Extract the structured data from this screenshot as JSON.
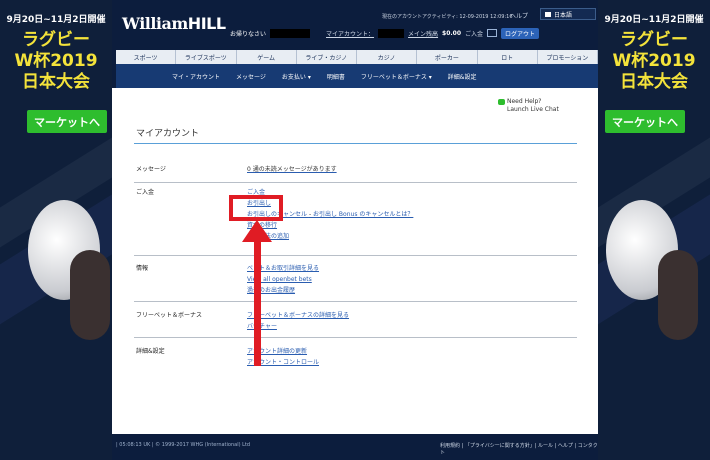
{
  "banner": {
    "dates": "9月20日~11月2日開催",
    "line1": "ラグビー",
    "line2": "W杯2019",
    "line3": "日本大会",
    "button": "マーケットへ"
  },
  "header": {
    "logo_script": "William",
    "logo_block": "HILL",
    "activity_link": "現在のアカウントアクティビティ: 12-09-2019 12:09:16",
    "help": "ヘルプ",
    "language": "日本語",
    "greeting": "お帰りなさい",
    "my_account": "マイアカウント：",
    "main_wallet": "メイン残高",
    "balance": "$0.00",
    "deposit": "ご入金",
    "logout": "ログアウト"
  },
  "nav_primary": [
    "スポーツ",
    "ライブスポーツ",
    "ゲーム",
    "ライブ・カジノ",
    "カジノ",
    "ポーカー",
    "ロト",
    "プロモーション"
  ],
  "nav_secondary": [
    "マイ・アカウント",
    "メッセージ",
    "お支払い ▾",
    "明細書",
    "フリーベット＆ボーナス ▾",
    "詳細&設定"
  ],
  "content": {
    "need_help": "Need Help?",
    "live_chat": "Launch Live Chat",
    "page_title": "マイアカウント",
    "sections": [
      {
        "label": "メッセージ",
        "links": [
          "0 通の未読メッセージがあります"
        ]
      },
      {
        "label": "ご入金",
        "links": [
          "ご入金",
          "お引出し",
          "お引出しのキャンセル",
          "お引出し Bonus のキャンセルとは？",
          "資金の移行",
          "入金方法の追加"
        ]
      },
      {
        "label": "情報",
        "links": [
          "ベット＆お取引詳細を見る",
          "View all openbet bets",
          "過去のお出金履歴"
        ]
      },
      {
        "label": "フリーベット＆ボーナス",
        "links": [
          "フリーベット＆ボーナスの詳細を見る",
          "バウチャー"
        ]
      },
      {
        "label": "詳細&設定",
        "links": [
          "アカウント詳細の更新",
          "アカウント・コントロール"
        ]
      }
    ]
  },
  "footer": {
    "left": "| 05:08:13 UK | © 1999-2017 WHG (International) Ltd",
    "right": "利用規約 | 「プライバシーに関する方針」| ルール | ヘルプ | コンタクト"
  },
  "colors": {
    "highlight": "#e01c24",
    "nav_dark": "#173a73",
    "banner_green": "#2ebd2e",
    "banner_text": "#f4e33a"
  }
}
